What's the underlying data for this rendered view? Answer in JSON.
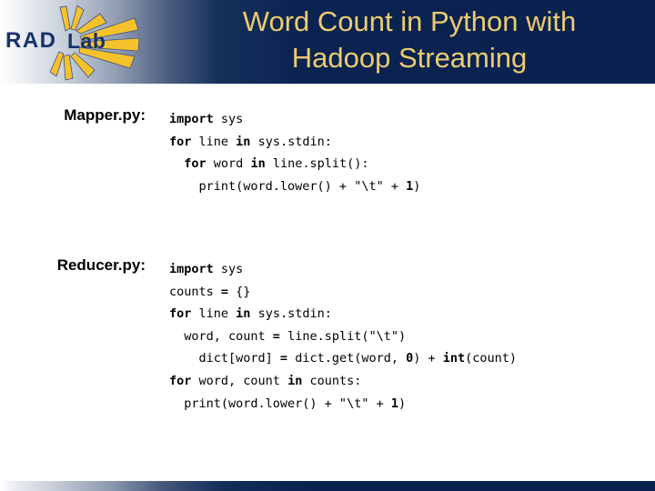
{
  "slide": {
    "title_line1": "Word Count in Python with",
    "title_line2": "Hadoop Streaming",
    "title_color": "#edcb6f",
    "header_bg_dark": "#0a2250",
    "body_bg": "#ffffff"
  },
  "logo": {
    "name": "rad-lab-logo",
    "text_rad": "RAD",
    "text_lab": "Lab",
    "text_color": "#17326b",
    "ray_color": "#f5c22b",
    "ray_outline": "#3a4a7a"
  },
  "sections": [
    {
      "label": "Mapper.py:",
      "name": "mapper",
      "code_lines": [
        [
          {
            "t": "import",
            "bold": true
          },
          {
            "t": " sys",
            "bold": false
          }
        ],
        [
          {
            "t": "for",
            "bold": true
          },
          {
            "t": " line ",
            "bold": false
          },
          {
            "t": "in",
            "bold": true
          },
          {
            "t": " sys.stdin:",
            "bold": false
          }
        ],
        [
          {
            "t": "  ",
            "bold": false
          },
          {
            "t": "for",
            "bold": true
          },
          {
            "t": " word ",
            "bold": false
          },
          {
            "t": "in",
            "bold": true
          },
          {
            "t": " line.split():",
            "bold": false
          }
        ],
        [
          {
            "t": "    print(word.lower() + \"\\t\" + ",
            "bold": false
          },
          {
            "t": "1",
            "bold": true
          },
          {
            "t": ")",
            "bold": false
          }
        ]
      ],
      "code_plain": [
        "import sys",
        "for line in sys.stdin:",
        "  for word in line.split():",
        "    print(word.lower() + \"\\t\" + 1)"
      ]
    },
    {
      "label": "Reducer.py:",
      "name": "reducer",
      "code_lines": [
        [
          {
            "t": "import",
            "bold": true
          },
          {
            "t": " sys",
            "bold": false
          }
        ],
        [
          {
            "t": "counts ",
            "bold": false
          },
          {
            "t": "=",
            "bold": true
          },
          {
            "t": " {}",
            "bold": false
          }
        ],
        [
          {
            "t": "for",
            "bold": true
          },
          {
            "t": " line ",
            "bold": false
          },
          {
            "t": "in",
            "bold": true
          },
          {
            "t": " sys.stdin:",
            "bold": false
          }
        ],
        [
          {
            "t": "  word, count ",
            "bold": false
          },
          {
            "t": "=",
            "bold": true
          },
          {
            "t": " line.split(\"\\t\")",
            "bold": false
          }
        ],
        [
          {
            "t": "    dict[word] ",
            "bold": false
          },
          {
            "t": "=",
            "bold": true
          },
          {
            "t": " dict.get(word, ",
            "bold": false
          },
          {
            "t": "0",
            "bold": true
          },
          {
            "t": ") + ",
            "bold": false
          },
          {
            "t": "int",
            "bold": true
          },
          {
            "t": "(count)",
            "bold": false
          }
        ],
        [
          {
            "t": "for",
            "bold": true
          },
          {
            "t": " word, count ",
            "bold": false
          },
          {
            "t": "in",
            "bold": true
          },
          {
            "t": " counts:",
            "bold": false
          }
        ],
        [
          {
            "t": "  print(word.lower() + \"\\t\" + ",
            "bold": false
          },
          {
            "t": "1",
            "bold": true
          },
          {
            "t": ")",
            "bold": false
          }
        ]
      ],
      "code_plain": [
        "import sys",
        "counts = {}",
        "for line in sys.stdin:",
        "  word, count = line.split(\"\\t\")",
        "    dict[word] = dict.get(word, 0) + int(count)",
        "for word, count in counts:",
        "  print(word.lower() + \"\\t\" + 1)"
      ]
    }
  ]
}
